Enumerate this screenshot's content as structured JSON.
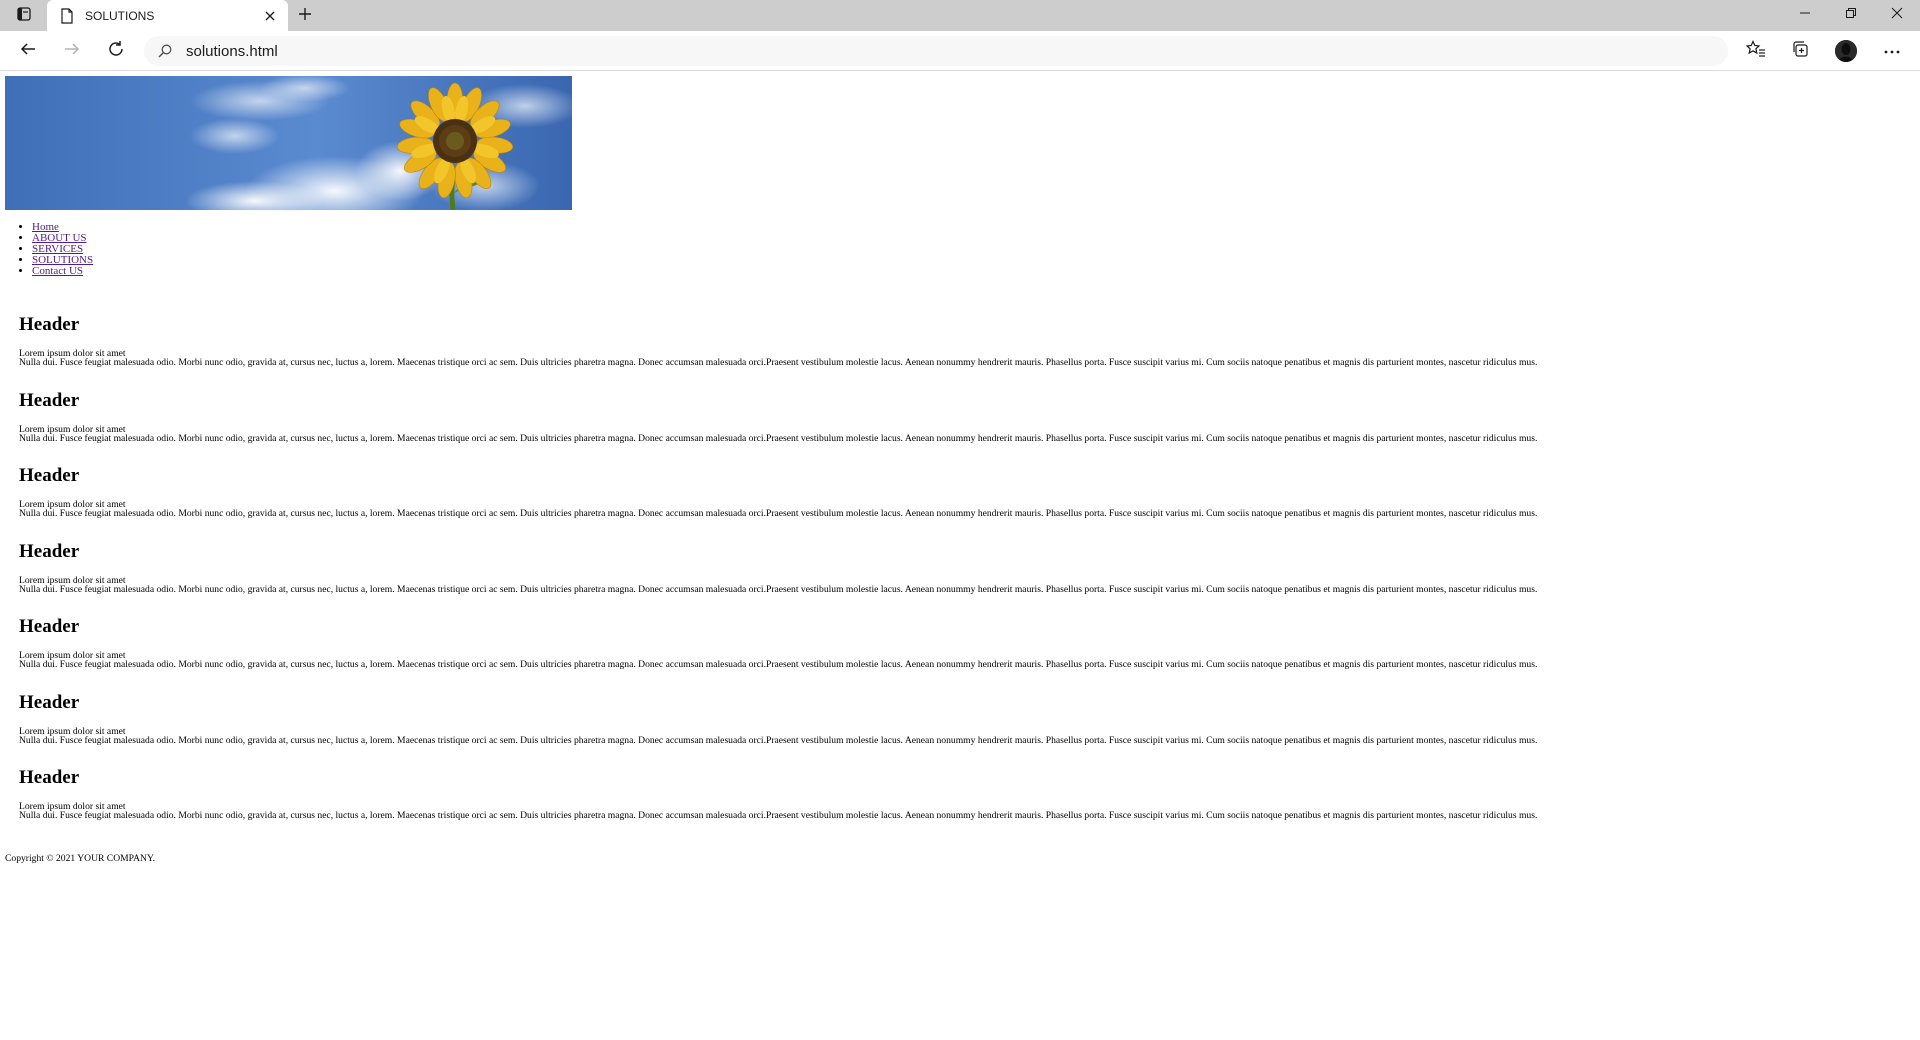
{
  "browser": {
    "tab_title": "SOLUTIONS",
    "url": "solutions.html"
  },
  "page": {
    "menu": [
      {
        "label": "Home"
      },
      {
        "label": "ABOUT US"
      },
      {
        "label": "SERVICES"
      },
      {
        "label": "SOLUTIONS"
      },
      {
        "label": "Contact US"
      }
    ],
    "sections": [
      {
        "header": "Header",
        "line1": "Lorem ipsum dolor sit amet",
        "line2": "Nulla dui. Fusce feugiat malesuada odio. Morbi nunc odio, gravida at, cursus nec, luctus a, lorem. Maecenas tristique orci ac sem. Duis ultricies pharetra magna. Donec accumsan malesuada orci.Praesent vestibulum molestie lacus. Aenean nonummy hendrerit mauris. Phasellus porta. Fusce suscipit varius mi. Cum sociis natoque penatibus et magnis dis parturient montes, nascetur ridiculus mus."
      },
      {
        "header": "Header",
        "line1": "Lorem ipsum dolor sit amet",
        "line2": "Nulla dui. Fusce feugiat malesuada odio. Morbi nunc odio, gravida at, cursus nec, luctus a, lorem. Maecenas tristique orci ac sem. Duis ultricies pharetra magna. Donec accumsan malesuada orci.Praesent vestibulum molestie lacus. Aenean nonummy hendrerit mauris. Phasellus porta. Fusce suscipit varius mi. Cum sociis natoque penatibus et magnis dis parturient montes, nascetur ridiculus mus."
      },
      {
        "header": "Header",
        "line1": "Lorem ipsum dolor sit amet",
        "line2": "Nulla dui. Fusce feugiat malesuada odio. Morbi nunc odio, gravida at, cursus nec, luctus a, lorem. Maecenas tristique orci ac sem. Duis ultricies pharetra magna. Donec accumsan malesuada orci.Praesent vestibulum molestie lacus. Aenean nonummy hendrerit mauris. Phasellus porta. Fusce suscipit varius mi. Cum sociis natoque penatibus et magnis dis parturient montes, nascetur ridiculus mus."
      },
      {
        "header": "Header",
        "line1": "Lorem ipsum dolor sit amet",
        "line2": "Nulla dui. Fusce feugiat malesuada odio. Morbi nunc odio, gravida at, cursus nec, luctus a, lorem. Maecenas tristique orci ac sem. Duis ultricies pharetra magna. Donec accumsan malesuada orci.Praesent vestibulum molestie lacus. Aenean nonummy hendrerit mauris. Phasellus porta. Fusce suscipit varius mi. Cum sociis natoque penatibus et magnis dis parturient montes, nascetur ridiculus mus."
      },
      {
        "header": "Header",
        "line1": "Lorem ipsum dolor sit amet",
        "line2": "Nulla dui. Fusce feugiat malesuada odio. Morbi nunc odio, gravida at, cursus nec, luctus a, lorem. Maecenas tristique orci ac sem. Duis ultricies pharetra magna. Donec accumsan malesuada orci.Praesent vestibulum molestie lacus. Aenean nonummy hendrerit mauris. Phasellus porta. Fusce suscipit varius mi. Cum sociis natoque penatibus et magnis dis parturient montes, nascetur ridiculus mus."
      },
      {
        "header": "Header",
        "line1": "Lorem ipsum dolor sit amet",
        "line2": "Nulla dui. Fusce feugiat malesuada odio. Morbi nunc odio, gravida at, cursus nec, luctus a, lorem. Maecenas tristique orci ac sem. Duis ultricies pharetra magna. Donec accumsan malesuada orci.Praesent vestibulum molestie lacus. Aenean nonummy hendrerit mauris. Phasellus porta. Fusce suscipit varius mi. Cum sociis natoque penatibus et magnis dis parturient montes, nascetur ridiculus mus."
      },
      {
        "header": "Header",
        "line1": "Lorem ipsum dolor sit amet",
        "line2": "Nulla dui. Fusce feugiat malesuada odio. Morbi nunc odio, gravida at, cursus nec, luctus a, lorem. Maecenas tristique orci ac sem. Duis ultricies pharetra magna. Donec accumsan malesuada orci.Praesent vestibulum molestie lacus. Aenean nonummy hendrerit mauris. Phasellus porta. Fusce suscipit varius mi. Cum sociis natoque penatibus et magnis dis parturient montes, nascetur ridiculus mus."
      }
    ],
    "footer": "Copyright © 2021 YOUR COMPANY."
  },
  "icons": {
    "tab_actions": "tab-actions-icon",
    "page": "page-icon",
    "close": "close-icon",
    "new_tab": "plus-icon",
    "minimize": "minimize-icon",
    "restore": "restore-icon",
    "window_close": "close-icon",
    "back": "back-arrow-icon",
    "forward": "forward-arrow-icon",
    "refresh": "refresh-icon",
    "search": "search-icon",
    "favorites": "favorites-icon",
    "collections": "collections-icon",
    "profile": "profile-avatar",
    "more": "more-icon"
  },
  "colors": {
    "tabbar_bg": "#cdcdcd",
    "visited_link": "#551a8b",
    "sky": "#4a78c0",
    "sunflower": "#e9b21a"
  }
}
